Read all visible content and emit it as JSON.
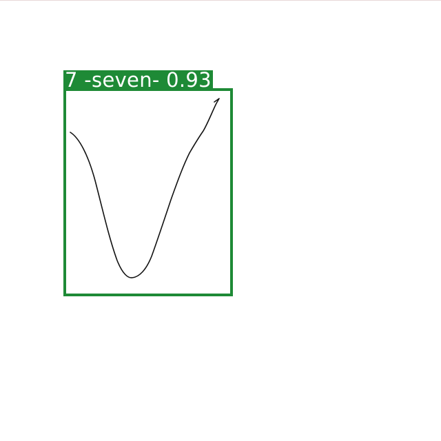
{
  "detection": {
    "label": "7 -seven- 0.93",
    "box_color": "#1e8a36",
    "label_text_color": "#ffffff"
  },
  "stroke": {
    "color": "#111111",
    "icon": "handwritten-v-stroke"
  }
}
